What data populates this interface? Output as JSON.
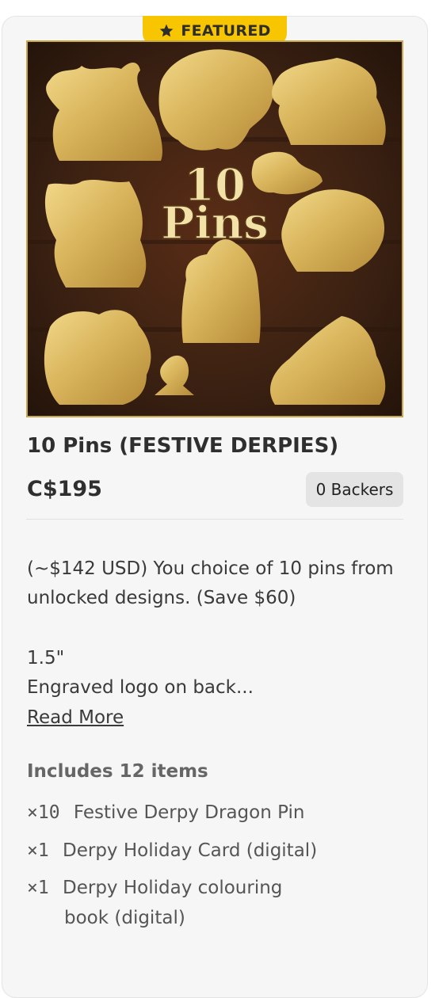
{
  "badge": {
    "label": "FEATURED",
    "icon": "star-icon",
    "color": "#f7c600"
  },
  "product": {
    "image_alt": "10 Pins",
    "image_text_line1": "10",
    "image_text_line2": "Pins",
    "title": "10 Pins (FESTIVE DERPIES)",
    "price": "C$195",
    "backers": "0 Backers",
    "description_lines": [
      "(~$142 USD) You choice of 10 pins from",
      "unlocked designs. (Save $60)",
      "1.5\"",
      "Engraved logo on back..."
    ],
    "read_more": "Read More",
    "includes_label": "Includes 12 items",
    "items": [
      {
        "qty": "×10",
        "name": "Festive Derpy Dragon Pin"
      },
      {
        "qty": "×1",
        "name": "Derpy Holiday Card (digital)"
      },
      {
        "qty": "×1",
        "name_line1": "Derpy Holiday colouring",
        "name_line2": "book (digital)"
      }
    ]
  }
}
